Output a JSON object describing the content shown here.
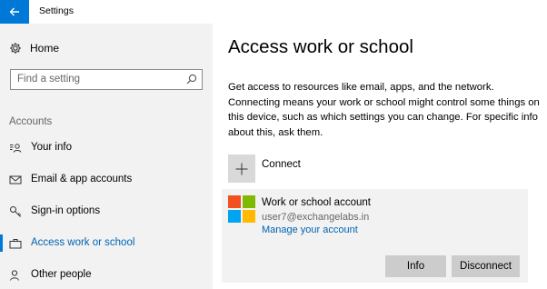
{
  "window": {
    "title": "Settings"
  },
  "sidebar": {
    "home_label": "Home",
    "search_placeholder": "Find a setting",
    "section_header": "Accounts",
    "items": [
      {
        "label": "Your info",
        "icon": "person-card-icon",
        "active": false
      },
      {
        "label": "Email & app accounts",
        "icon": "envelope-icon",
        "active": false
      },
      {
        "label": "Sign-in options",
        "icon": "key-icon",
        "active": false
      },
      {
        "label": "Access work or school",
        "icon": "briefcase-icon",
        "active": true
      },
      {
        "label": "Other people",
        "icon": "person-add-icon",
        "active": false
      }
    ]
  },
  "main": {
    "title": "Access work or school",
    "description": "Get access to resources like email, apps, and the network. Connecting means your work or school might control some things on this device, such as which settings you can change. For specific info about this, ask them.",
    "connect_label": "Connect",
    "account": {
      "name": "Work or school account",
      "email": "user7@exchangelabs.in",
      "manage_link": "Manage your account",
      "info_button": "Info",
      "disconnect_button": "Disconnect"
    }
  },
  "colors": {
    "accent": "#0078d7",
    "link": "#0063b1",
    "sidebar_bg": "#f2f2f2",
    "ms_red": "#f25022",
    "ms_green": "#7fba00",
    "ms_blue": "#00a4ef",
    "ms_yellow": "#ffb900"
  }
}
